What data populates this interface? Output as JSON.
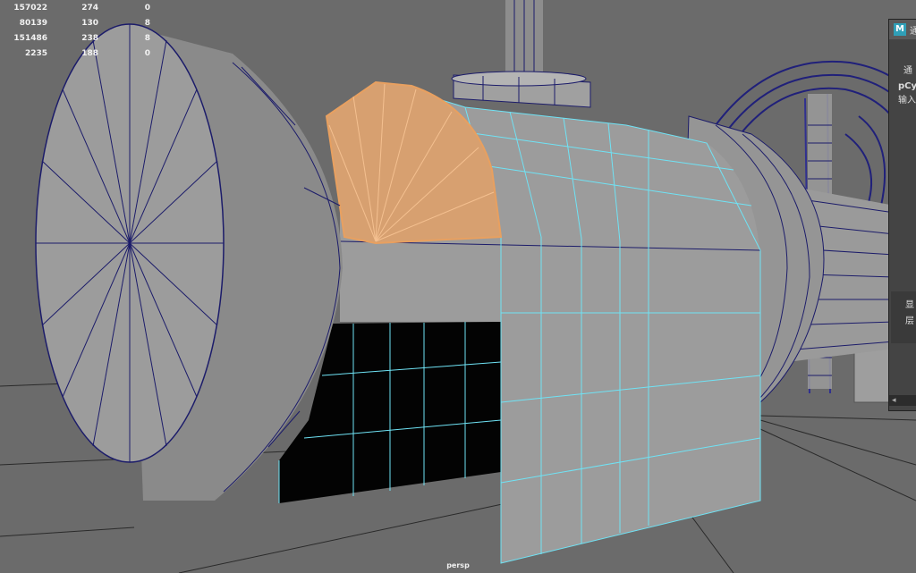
{
  "hud": {
    "rows": [
      [
        "157022",
        "274",
        "0"
      ],
      [
        "80139",
        "130",
        "8"
      ],
      [
        "151486",
        "238",
        "8"
      ],
      [
        "2235",
        "188",
        "0"
      ]
    ]
  },
  "viewport": {
    "camera_label": "persp"
  },
  "panel": {
    "logo": "M",
    "title": "通",
    "line1": "通",
    "node_name": "pCy",
    "input_label": "输入",
    "display_label": "显",
    "layer_label": "层",
    "scroll_arrow": "◂"
  },
  "colors": {
    "background": "#6b6b6b",
    "mesh_fill": "#9a9a9a",
    "wire": "#1c1c6a",
    "selected_face": "#e8a060",
    "highlight_edges": "#6fe3f5"
  }
}
